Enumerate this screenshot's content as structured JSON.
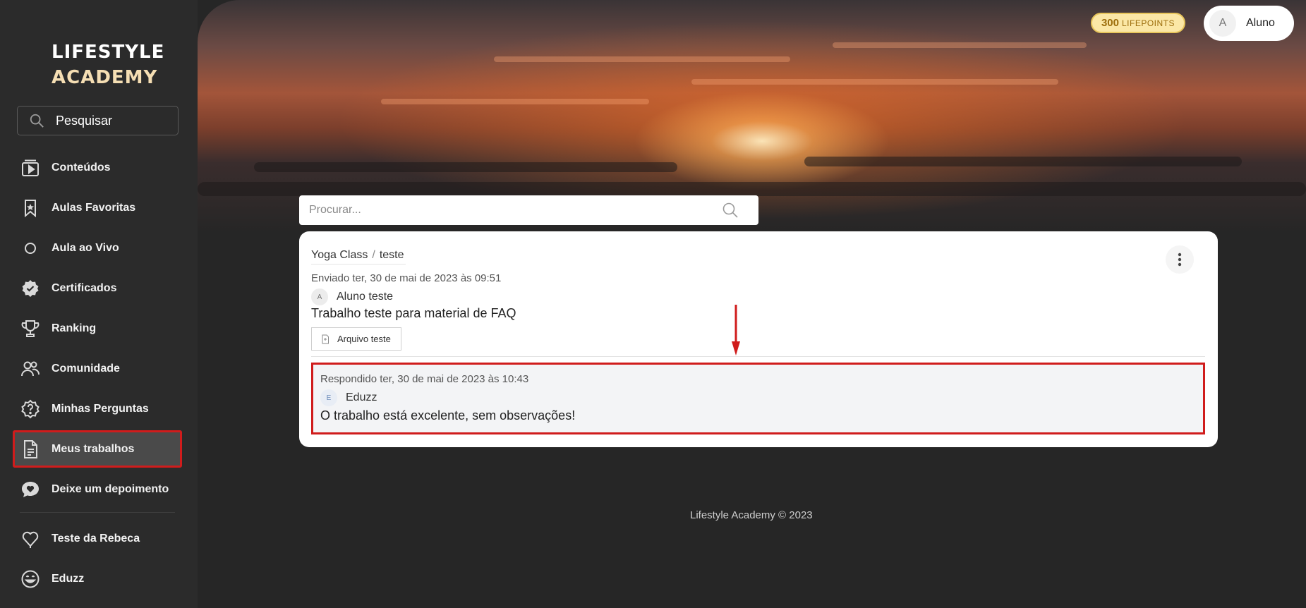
{
  "brand": {
    "line1": "LIFESTYLE",
    "line2": "ACADEMY"
  },
  "sidebar": {
    "search_label": "Pesquisar",
    "items": [
      {
        "label": "Conteúdos",
        "icon": "play-icon"
      },
      {
        "label": "Aulas Favoritas",
        "icon": "bookmark-star-icon"
      },
      {
        "label": "Aula ao Vivo",
        "icon": "circle-icon"
      },
      {
        "label": "Certificados",
        "icon": "badge-check-icon"
      },
      {
        "label": "Ranking",
        "icon": "trophy-icon"
      },
      {
        "label": "Comunidade",
        "icon": "users-icon"
      },
      {
        "label": "Minhas Perguntas",
        "icon": "question-icon"
      },
      {
        "label": "Meus trabalhos",
        "icon": "document-icon",
        "active": true
      },
      {
        "label": "Deixe um depoimento",
        "icon": "heart-chat-icon"
      }
    ],
    "extra_items": [
      {
        "label": "Teste da Rebeca",
        "icon": "heart-outline-icon"
      },
      {
        "label": "Eduzz",
        "icon": "smiley-icon"
      }
    ]
  },
  "header": {
    "points_value": "300",
    "points_unit": "LIFEPOINTS",
    "user_initial": "A",
    "user_name": "Aluno"
  },
  "main": {
    "search_placeholder": "Procurar...",
    "card": {
      "course": "Yoga Class",
      "separator": "/",
      "lesson": "teste",
      "sent_label": "Enviado ter, 30 de mai de 2023 às 09:51",
      "author_initial": "A",
      "author_name": "Aluno teste",
      "work_title": "Trabalho teste para material de FAQ",
      "file_label": "Arquivo teste",
      "reply": {
        "date_label": "Respondido ter, 30 de mai de 2023 às 10:43",
        "author_initial": "E",
        "author_name": "Eduzz",
        "text": "O trabalho está excelente, sem observações!"
      }
    }
  },
  "footer": {
    "text": "Lifestyle Academy © 2023"
  },
  "colors": {
    "highlight": "#d01c1c",
    "points_bg": "#fbe7a6",
    "sidebar_bg": "#2b2b2b"
  }
}
